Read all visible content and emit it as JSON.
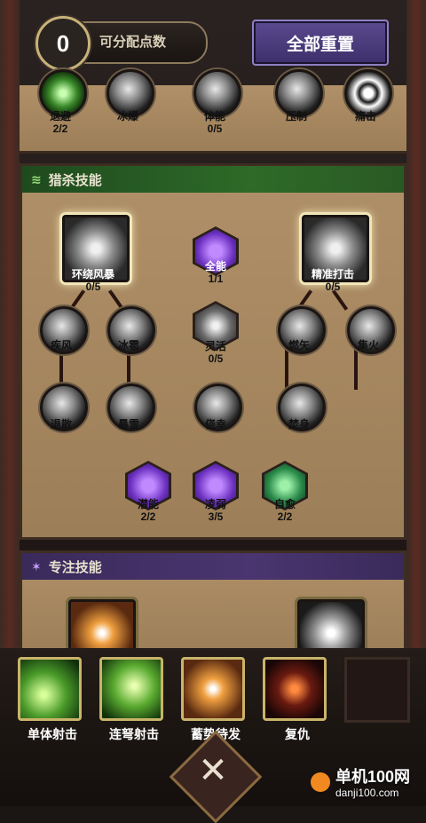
{
  "header": {
    "points_value": "0",
    "points_label": "可分配点数",
    "reset_label": "全部重置"
  },
  "top_row": [
    {
      "name": "退避",
      "count": "2/2"
    },
    {
      "name": "冰爆",
      "count": ""
    },
    {
      "name": "体能",
      "count": "0/5"
    },
    {
      "name": "压制",
      "count": ""
    },
    {
      "name": "痛击",
      "count": ""
    }
  ],
  "hunt": {
    "title": "猎杀技能",
    "nodes": {
      "huanrao": {
        "name": "环绕风暴",
        "count": "0/5"
      },
      "quanneng": {
        "name": "全能",
        "count": "1/1"
      },
      "jingzhun": {
        "name": "精准打击",
        "count": "0/5"
      },
      "jifeng": {
        "name": "疾风",
        "count": ""
      },
      "bingbao": {
        "name": "冰雹",
        "count": ""
      },
      "linghuo": {
        "name": "灵活",
        "count": "0/5"
      },
      "ranshi": {
        "name": "燃矢",
        "count": ""
      },
      "jihuo": {
        "name": "集火",
        "count": ""
      },
      "tuisan": {
        "name": "退散",
        "count": ""
      },
      "baoxue": {
        "name": "暴雪",
        "count": ""
      },
      "jiaoxing": {
        "name": "侥幸",
        "count": ""
      },
      "fenshen": {
        "name": "焚身",
        "count": ""
      },
      "qianneng": {
        "name": "潜能",
        "count": "2/2"
      },
      "lingruo": {
        "name": "凌弱",
        "count": "3/5"
      },
      "ziyu": {
        "name": "自愈",
        "count": "2/2"
      }
    }
  },
  "focus": {
    "title": "专注技能"
  },
  "skills": [
    "单体射击",
    "连弩射击",
    "蓄势待发",
    "复仇"
  ],
  "watermark": {
    "line1": "单机100网",
    "line2": "danji100.com"
  },
  "colors": {
    "hunt_header": "#2e6a28",
    "focus_header": "#4a3570",
    "reset_button": "#4a3a80",
    "slot_border": "#c9b46a"
  }
}
